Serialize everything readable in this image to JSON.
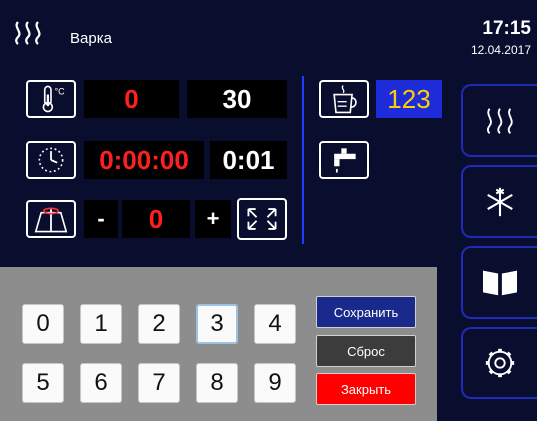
{
  "header": {
    "title": "Варка",
    "time": "17:15",
    "date": "12.04.2017",
    "icon": "steam-icon"
  },
  "temperature": {
    "icon": "thermometer-icon",
    "unit": "°C",
    "current": "0",
    "target": "30"
  },
  "timer": {
    "icon": "clock-icon",
    "elapsed": "0:00:00",
    "set": "0:01"
  },
  "fan": {
    "icon": "fan-icon",
    "minus": "-",
    "value": "0",
    "plus": "+",
    "expand_icon": "expand-icon"
  },
  "cup": {
    "icon": "cup-icon",
    "value": "123"
  },
  "tap": {
    "icon": "tap-icon"
  },
  "sidebar": [
    {
      "name": "steam",
      "icon": "steam-icon"
    },
    {
      "name": "freeze",
      "icon": "snowflake-icon"
    },
    {
      "name": "book",
      "icon": "book-icon"
    },
    {
      "name": "settings",
      "icon": "gear-icon"
    }
  ],
  "keypad": {
    "keys": [
      "0",
      "1",
      "2",
      "3",
      "4",
      "5",
      "6",
      "7",
      "8",
      "9"
    ],
    "save_label": "Сохранить",
    "reset_label": "Сброс",
    "close_label": "Закрыть"
  },
  "colors": {
    "background": "#0a0e2e",
    "accent": "#1e2bb8",
    "value_red": "#ff1f1f",
    "value_yellow": "#ffd000",
    "close": "#ff0000"
  }
}
